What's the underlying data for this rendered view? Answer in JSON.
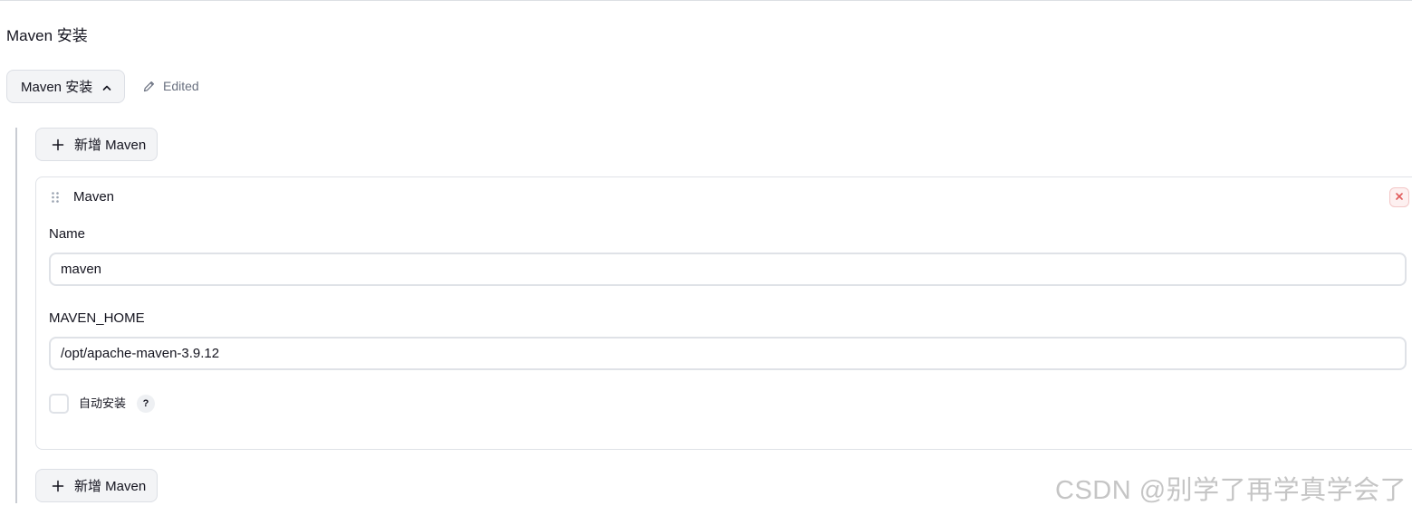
{
  "section": {
    "title": "Maven 安装",
    "toggle_label": "Maven 安装",
    "toggle_icon": "chevron-up-icon",
    "edited_label": "Edited",
    "edited_icon": "pencil-icon"
  },
  "add_button_label": "新增 Maven",
  "add_button_icon": "plus-icon",
  "card": {
    "title": "Maven",
    "drag_icon": "drag-handle-icon",
    "close_icon": "close-icon",
    "name_label": "Name",
    "name_value": "maven",
    "home_label": "MAVEN_HOME",
    "home_value": "/opt/apache-maven-3.9.12",
    "auto_install_label": "自动安装",
    "auto_install_checked": false,
    "help_label": "?"
  },
  "watermark": "CSDN @别学了再学真学会了",
  "colors": {
    "close_accent": "#e05a5a",
    "border": "#dfe2e7",
    "muted_text": "#6a7180"
  }
}
